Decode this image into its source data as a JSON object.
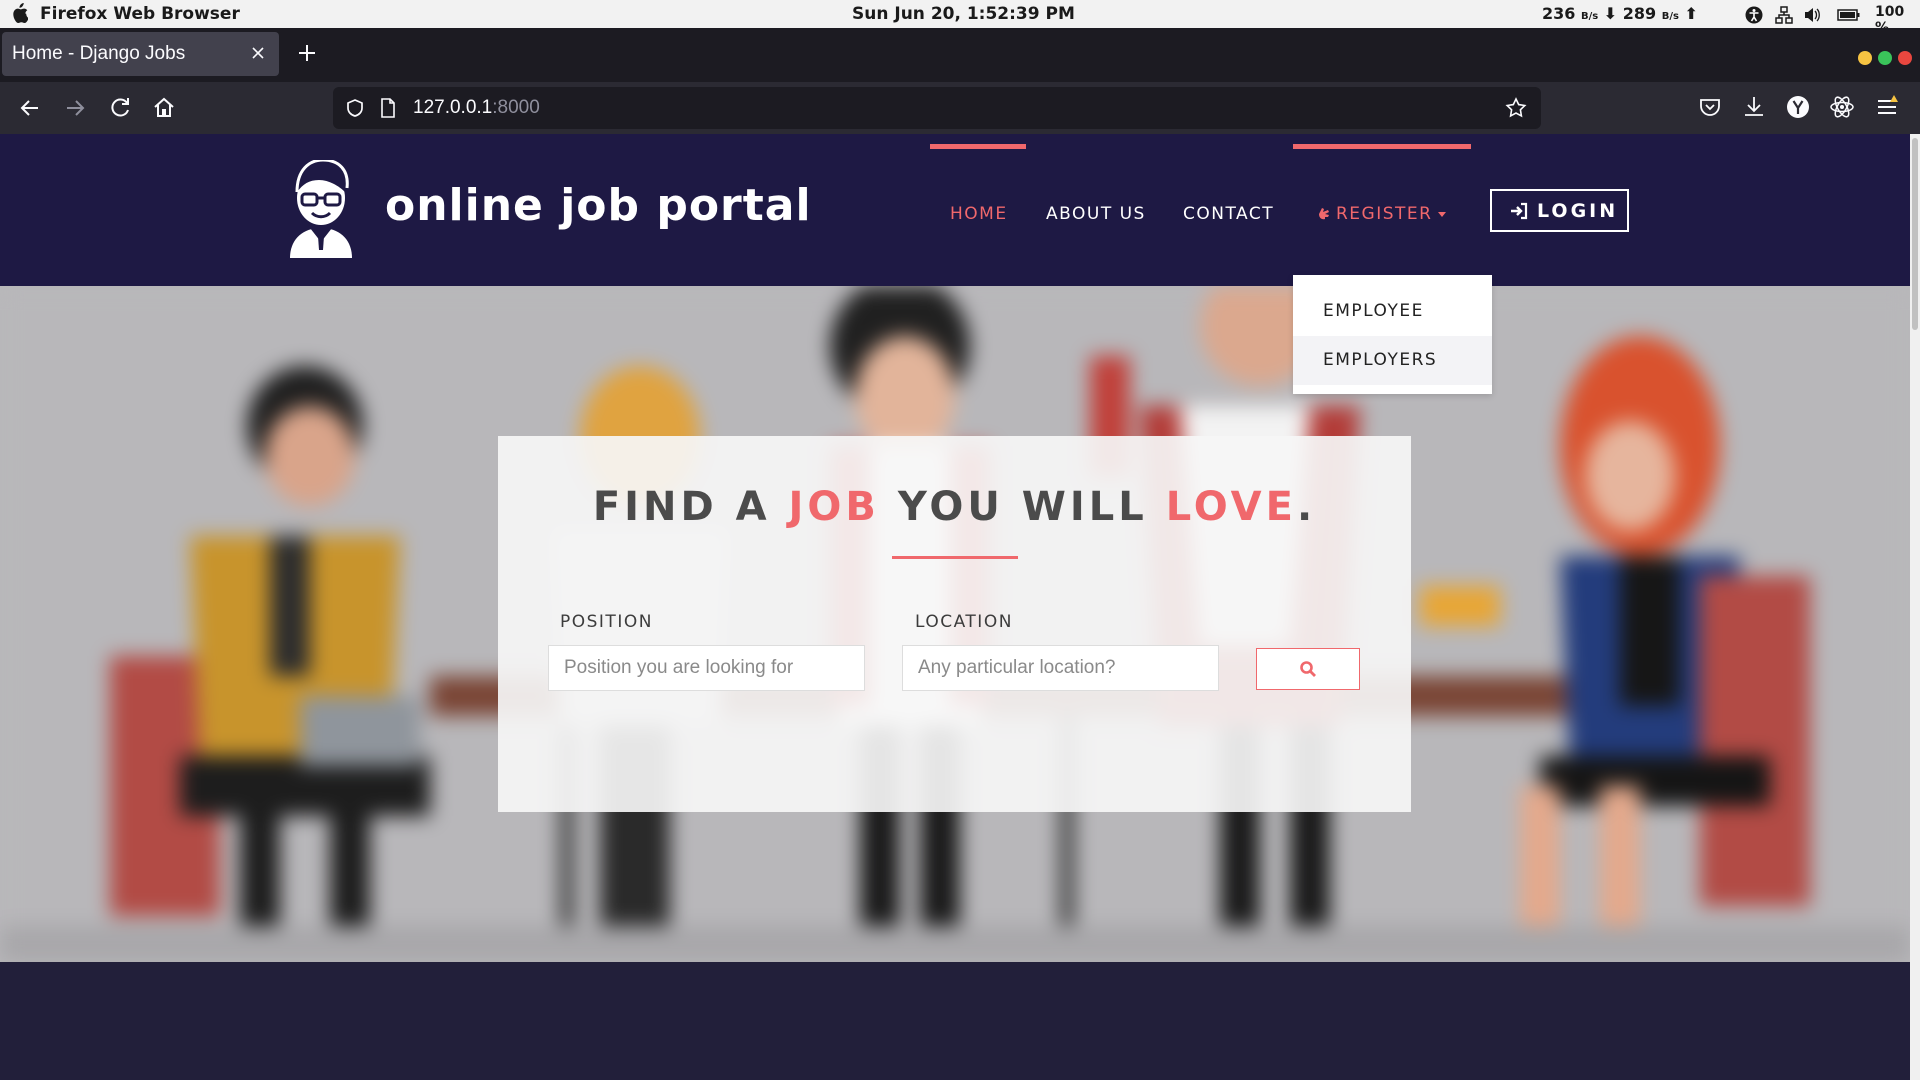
{
  "os_bar": {
    "app_name": "Firefox Web Browser",
    "clock": "Sun Jun 20,  1:52:39 PM",
    "net_down": "236",
    "net_down_unit": "B/s",
    "net_up": "289",
    "net_up_unit": "B/s",
    "battery": "100 %"
  },
  "browser": {
    "tab_title": "Home - Django Jobs",
    "url_host": "127.0.0.1",
    "url_port": ":8000"
  },
  "site": {
    "logo_text": "online job portal",
    "menu": {
      "home": "HOME",
      "about": "ABOUT US",
      "contact": "CONTACT",
      "register": "REGISTER",
      "login": "LOGIN"
    },
    "register_dropdown": [
      "EMPLOYEE",
      "EMPLOYERS"
    ],
    "hero": {
      "headline_1": "FIND A ",
      "headline_2": "JOB",
      "headline_3": " YOU WILL ",
      "headline_4": "LOVE",
      "headline_5": ".",
      "position_label": "POSITION",
      "position_placeholder": "Position you are looking for",
      "location_label": "LOCATION",
      "location_placeholder": "Any particular location?"
    }
  },
  "colors": {
    "accent": "#f0686c",
    "header_bg": "#1e1944",
    "footer_bg": "#221f3a"
  }
}
